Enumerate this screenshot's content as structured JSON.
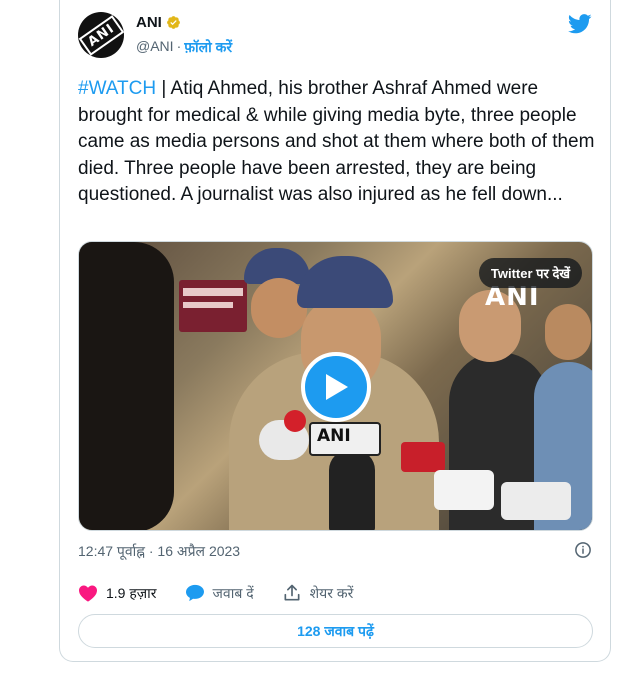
{
  "author": {
    "display_name": "ANI",
    "handle": "@ANI",
    "separator": "·",
    "follow_label": "फ़ॉलो करें",
    "avatar_text": "ANI"
  },
  "tweet": {
    "hashtag": "#WATCH",
    "text": " | Atiq Ahmed, his brother Ashraf Ahmed were brought for medical & while giving media byte, three people came as media persons and shot at them where both of them died. Three people have been arrested, they are being questioned. A journalist was also injured as he fell down..."
  },
  "media": {
    "view_on_twitter_label": "Twitter पर देखें",
    "watermark": "ANI",
    "mic_logo": "ANI"
  },
  "meta": {
    "timestamp": "12:47 पूर्वाह्न · 16 अप्रैल 2023"
  },
  "actions": {
    "like_count": "1.9 हज़ार",
    "reply_label": "जवाब दें",
    "share_label": "शेयर करें"
  },
  "replies": {
    "label": "128 जवाब पढ़ें"
  },
  "colors": {
    "accent": "#1d9bf0",
    "like": "#f91880",
    "text": "#0f1419",
    "muted": "#536471",
    "border": "#cfd9de"
  },
  "icons": [
    "verified-badge-icon",
    "twitter-bird-icon",
    "play-icon",
    "info-icon",
    "heart-icon",
    "reply-bubble-icon",
    "share-icon"
  ]
}
